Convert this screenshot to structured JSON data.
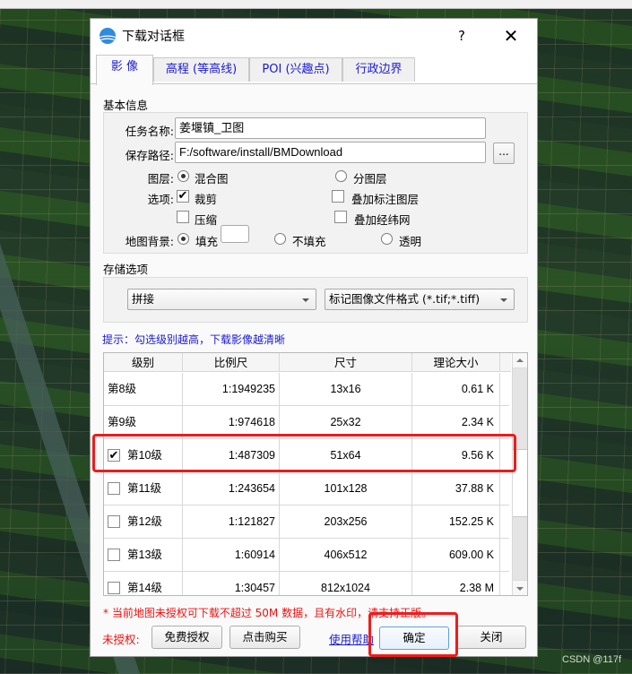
{
  "dialog": {
    "title": "下载对话框",
    "help_label": "?",
    "close_label": "✕",
    "icon": "app-logo-icon"
  },
  "tabs": [
    {
      "label": "影 像",
      "active": true
    },
    {
      "label": "高程 (等高线)",
      "active": false
    },
    {
      "label": "POI (兴趣点)",
      "active": false
    },
    {
      "label": "行政边界",
      "active": false
    }
  ],
  "basic_info": {
    "section_title": "基本信息",
    "task_name_label": "任务名称:",
    "task_name_value": "姜堰镇_卫图",
    "save_path_label": "保存路径:",
    "save_path_value": "F:/software/install/BMDownload",
    "browse_label": "...",
    "layer_label": "图层:",
    "layer_options": [
      {
        "label": "混合图",
        "selected": true
      },
      {
        "label": "分图层",
        "selected": false
      }
    ],
    "options_label": "选项:",
    "options": [
      {
        "label": "裁剪",
        "checked": true
      },
      {
        "label": "叠加标注图层",
        "checked": false
      },
      {
        "label": "压缩",
        "checked": false
      },
      {
        "label": "叠加经纬网",
        "checked": false
      }
    ],
    "background_label": "地图背景:",
    "background_options": [
      {
        "label": "填充",
        "selected": true
      },
      {
        "label": "不填充",
        "selected": false
      },
      {
        "label": "透明",
        "selected": false
      }
    ],
    "fill_color": "#ffffff",
    "check_mark": "✔"
  },
  "storage": {
    "section_title": "存储选项",
    "mode_value": "拼接",
    "format_value": "标记图像文件格式 (*.tif;*.tiff)"
  },
  "hint": "提示：勾选级别越高，下载影像越清晰",
  "levels_table": {
    "headers": [
      "级别",
      "比例尺",
      "尺寸",
      "理论大小"
    ],
    "rows": [
      {
        "level": "第8级",
        "scale": "1:1949235",
        "size": "13x16",
        "est_size": "0.61 K",
        "has_checkbox": false,
        "checked": false
      },
      {
        "level": "第9级",
        "scale": "1:974618",
        "size": "25x32",
        "est_size": "2.34 K",
        "has_checkbox": false,
        "checked": false
      },
      {
        "level": "第10级",
        "scale": "1:487309",
        "size": "51x64",
        "est_size": "9.56 K",
        "has_checkbox": true,
        "checked": true
      },
      {
        "level": "第11级",
        "scale": "1:243654",
        "size": "101x128",
        "est_size": "37.88 K",
        "has_checkbox": true,
        "checked": false
      },
      {
        "level": "第12级",
        "scale": "1:121827",
        "size": "203x256",
        "est_size": "152.25 K",
        "has_checkbox": true,
        "checked": false
      },
      {
        "level": "第13级",
        "scale": "1:60914",
        "size": "406x512",
        "est_size": "609.00 K",
        "has_checkbox": true,
        "checked": false
      },
      {
        "level": "第14级",
        "scale": "1:30457",
        "size": "812x1024",
        "est_size": "2.38 M",
        "has_checkbox": true,
        "checked": false
      }
    ]
  },
  "footer": {
    "warning": "* 当前地图未授权可下载不超过 50M 数据，且有水印，请支持正版。",
    "unauth_label": "未授权:",
    "free_license_label": "免费授权",
    "buy_label": "点击购买",
    "help_link": "使用帮助",
    "ok_label": "确定",
    "close_label": "关闭"
  },
  "annotations": {
    "highlight_color": "#ee1c1c"
  },
  "watermark": "CSDN @117f"
}
